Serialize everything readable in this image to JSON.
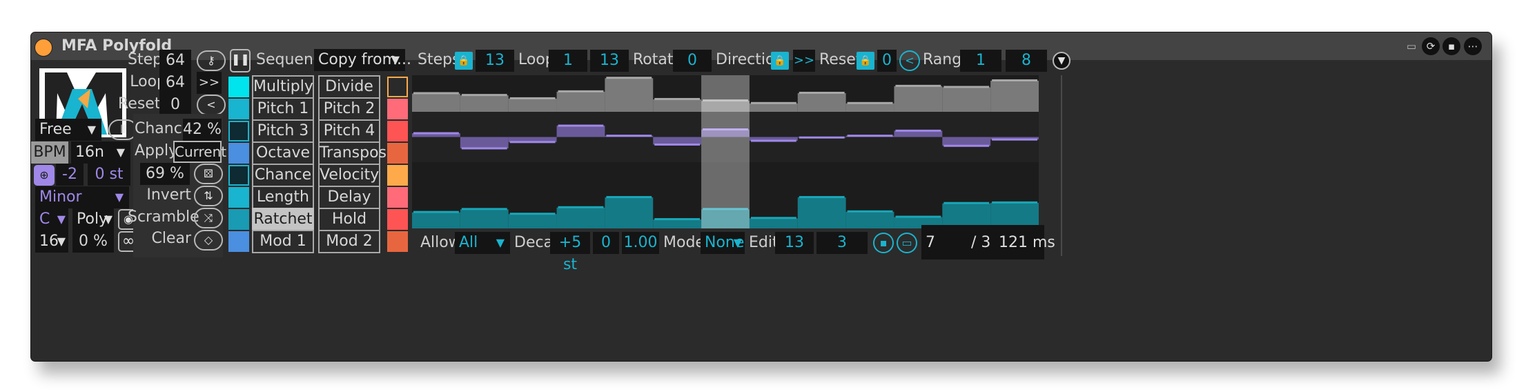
{
  "device": {
    "title": "MFA Polyfold",
    "icons": [
      "calendar-icon",
      "refresh-icon",
      "save-icon",
      "more-icon"
    ]
  },
  "left": {
    "steps_label": "Steps",
    "steps_value": "64",
    "loop_label": "Loop",
    "loop_value": "64",
    "loop_btn": ">>",
    "reset_label": "Reset",
    "reset_value": "0",
    "reset_btn": "<",
    "sync_mode": "Free",
    "bpm_label": "BPM",
    "rate": "16n",
    "transpose": "-2",
    "semitones": "0 st",
    "scale": "Minor",
    "key": "C",
    "voice_mode": "Poly",
    "division": "16",
    "swing": "0 %",
    "infinity": "∞"
  },
  "mid": {
    "chance_label": "Chance",
    "chance_value": "42 %",
    "apply_label": "Apply",
    "apply_value": "Current",
    "prob_value": "69 %",
    "invert_label": "Invert",
    "scramble_label": "Scramble",
    "clear_label": "Clear"
  },
  "sequence": {
    "label": "Sequence",
    "copy_from": "Copy from...",
    "left_buttons": [
      "Multiply",
      "Pitch 1",
      "Pitch 3",
      "Octave",
      "Chance",
      "Length",
      "Ratchet",
      "Mod 1"
    ],
    "right_buttons": [
      "Divide",
      "Pitch 2",
      "Pitch 4",
      "Transpose",
      "Velocity",
      "Delay",
      "Hold",
      "Mod 2"
    ],
    "left_colors": [
      "#00e4ee",
      "#19b4cf",
      "#0e2a33",
      "#4a8fe0",
      "#0e2a33",
      "#19b4cf",
      "#199bb3",
      "#4a8fe0"
    ],
    "right_colors": [
      "#2a2a2a",
      "#ff6b78",
      "#ff5454",
      "#e8663f",
      "#ffaa4a",
      "#ff6b78",
      "#ff5454",
      "#e8663f"
    ],
    "active_index": 6
  },
  "editor": {
    "steps_label": "Steps",
    "steps_value": "13",
    "loop_label": "Loop",
    "loop_start": "1",
    "loop_end": "13",
    "rotate_label": "Rotate",
    "rotate_value": "0",
    "direction_label": "Direction",
    "direction_value": ">>",
    "reset_label": "Reset",
    "reset_value": "0",
    "reset_btn": "<",
    "range_label": "Range",
    "range_low": "1",
    "range_high": "8"
  },
  "chart_data": {
    "type": "bar",
    "x": [
      1,
      2,
      3,
      4,
      5,
      6,
      7,
      8,
      9,
      10,
      11,
      12,
      13
    ],
    "playhead_step": 7,
    "series": [
      {
        "values": [
          0.5,
          0.45,
          0.36,
          0.55,
          0.92,
          0.34,
          0.3,
          0.23,
          0.51,
          0.23,
          0.7,
          0.67,
          0.85
        ]
      },
      {
        "values": [
          0.15,
          -0.45,
          -0.2,
          0.45,
          0.05,
          -0.3,
          0.3,
          -0.15,
          -0.02,
          0.05,
          0.25,
          -0.35,
          -0.1
        ]
      },
      {
        "values": [
          0.27,
          0.32,
          0.24,
          0.35,
          0.52,
          0.15,
          0.32,
          0.17,
          0.52,
          0.28,
          0.19,
          0.42,
          0.43
        ]
      }
    ],
    "colors": [
      "#a8a8a8",
      "#a088e8",
      "#19a7b8"
    ]
  },
  "bottom": {
    "allow_label": "Allow",
    "allow_value": "All",
    "decay_label": "Decay",
    "decay_st": "+5 st",
    "decay_a": "0",
    "decay_b": "1.00",
    "mode_label": "Mode",
    "mode_value": "None",
    "edit_label": "Edit",
    "edit_a": "13",
    "edit_b": "3",
    "readout_a": "7",
    "readout_b": "/ 3",
    "readout_c": "121 ms"
  }
}
